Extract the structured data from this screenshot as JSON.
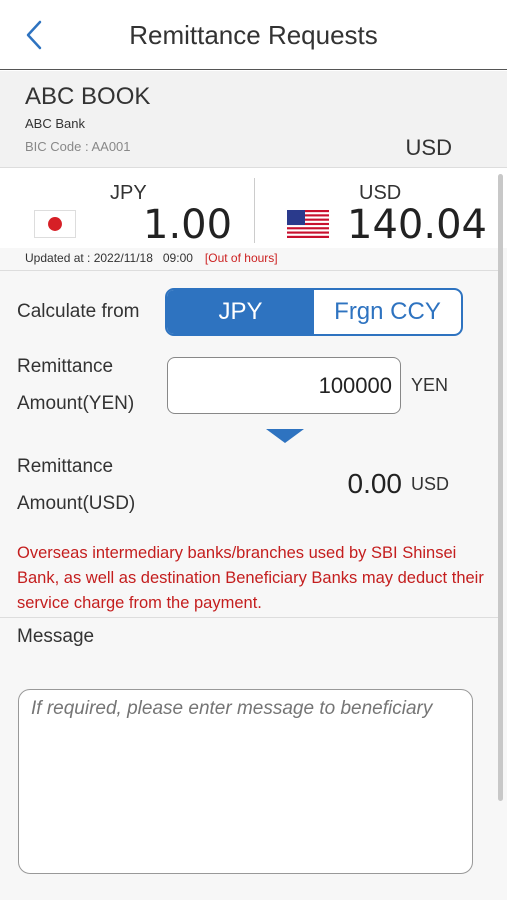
{
  "header": {
    "title": "Remittance Requests",
    "back_icon": "chevron-left-icon"
  },
  "account": {
    "name": "ABC BOOK",
    "bank": "ABC Bank",
    "bic": "BIC Code : AA001",
    "currency": "USD"
  },
  "rates": {
    "base": {
      "currency": "JPY",
      "value": "1.00",
      "flag": "japan-flag-icon"
    },
    "foreign": {
      "currency": "USD",
      "value": "140.04",
      "flag": "us-flag-icon"
    },
    "updated_at": "Updated at : 2022/11/18   09:00",
    "status": "[Out of hours]"
  },
  "calculate": {
    "label": "Calculate from",
    "options": [
      "JPY",
      "Frgn CCY"
    ],
    "selected": "JPY"
  },
  "remit_yen": {
    "label_line1": "Remittance",
    "label_line2": "Amount(YEN)",
    "value": "100000",
    "unit": "YEN"
  },
  "remit_usd": {
    "label_line1": "Remittance",
    "label_line2": "Amount(USD)",
    "value": "0.00",
    "unit": "USD"
  },
  "notice": "Overseas intermediary banks/branches used by SBI Shinsei Bank, as well as destination Beneficiary Banks may  deduct their service charge from the payment.",
  "message": {
    "label": "Message",
    "placeholder": "If required, please enter message to beneficiary"
  },
  "colors": {
    "accent": "#2e73c0",
    "warning": "#c41e1e"
  }
}
